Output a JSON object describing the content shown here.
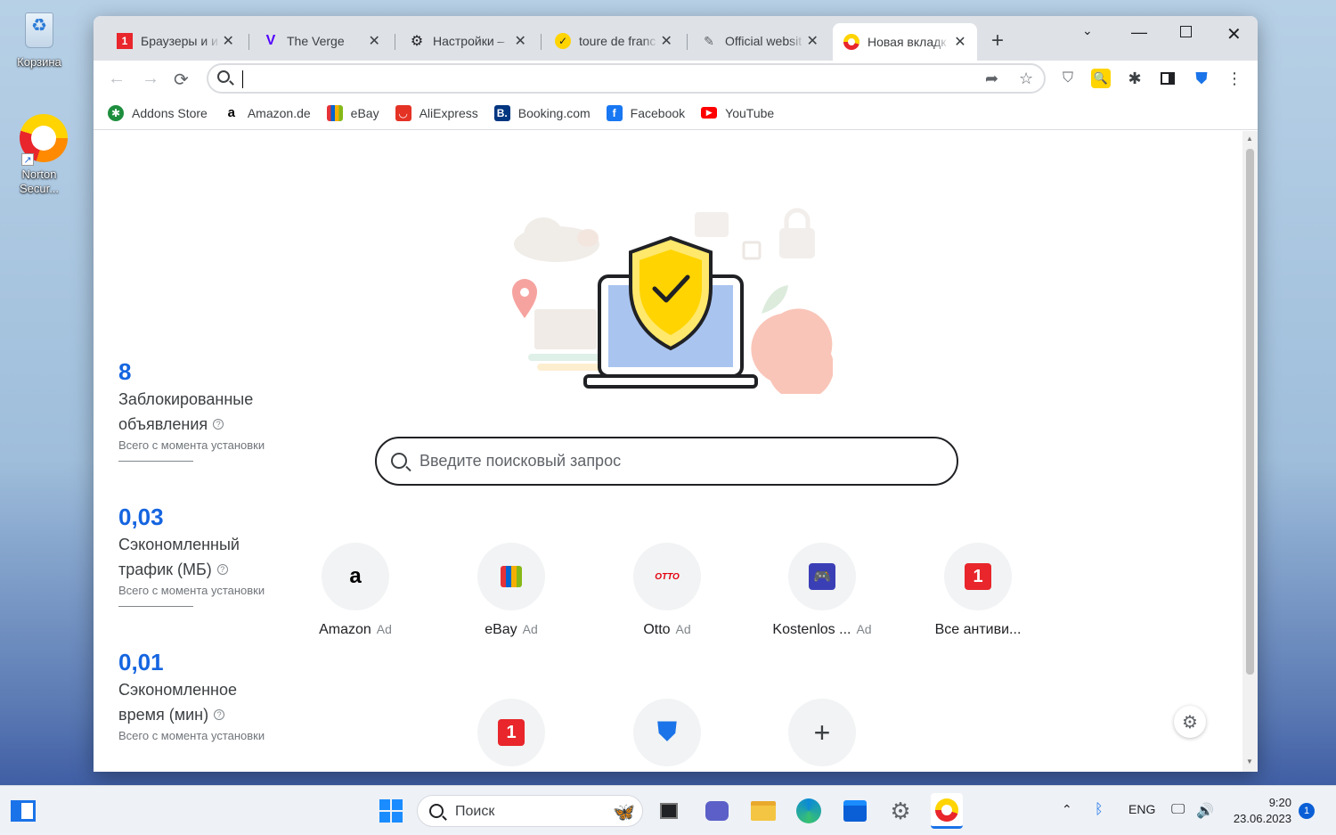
{
  "desktop": {
    "icons": [
      {
        "label": "Корзина"
      },
      {
        "label": "Norton Secur..."
      }
    ]
  },
  "browser": {
    "tabs": [
      {
        "title": "Браузеры и и",
        "icon": "brand-1-icon",
        "active": false
      },
      {
        "title": "The Verge",
        "icon": "verge-icon",
        "active": false
      },
      {
        "title": "Настройки – ",
        "icon": "gear-icon",
        "active": false
      },
      {
        "title": "toure de franc",
        "icon": "check-icon",
        "active": false
      },
      {
        "title": "Official websit",
        "icon": "official-site-icon",
        "active": false
      },
      {
        "title": "Новая вкладк",
        "icon": "norton-icon",
        "active": true
      }
    ],
    "omnibox_value": "",
    "bookmarks": [
      {
        "label": "Addons Store",
        "icon": "addons-icon",
        "color": "#1e8e3e"
      },
      {
        "label": "Amazon.de",
        "icon": "amazon-icon",
        "color": "#000000"
      },
      {
        "label": "eBay",
        "icon": "ebay-icon",
        "color": "#e53238"
      },
      {
        "label": "AliExpress",
        "icon": "aliexpress-icon",
        "color": "#e43225"
      },
      {
        "label": "Booking.com",
        "icon": "booking-icon",
        "color": "#003580"
      },
      {
        "label": "Facebook",
        "icon": "facebook-icon",
        "color": "#1877f2"
      },
      {
        "label": "YouTube",
        "icon": "youtube-icon",
        "color": "#ff0000"
      }
    ]
  },
  "newtab": {
    "stats": [
      {
        "value": "8",
        "label_line1": "Заблокированные",
        "label_line2": "объявления",
        "sub": "Всего с момента установки"
      },
      {
        "value": "0,03",
        "label_line1": "Сэкономленный",
        "label_line2": "трафик (МБ)",
        "sub": "Всего с момента установки"
      },
      {
        "value": "0,01",
        "label_line1": "Сэкономленное",
        "label_line2": "время (мин)",
        "sub": "Всего с момента установки"
      }
    ],
    "search_placeholder": "Введите поисковый запрос",
    "tiles_row1": [
      {
        "name": "Amazon",
        "ad": "Ad",
        "logo": "a"
      },
      {
        "name": "eBay",
        "ad": "Ad",
        "logo": ""
      },
      {
        "name": "Otto",
        "ad": "Ad",
        "logo": "OTTO"
      },
      {
        "name": "Kostenlos ...",
        "ad": "Ad",
        "logo": ""
      },
      {
        "name": "Все антиви...",
        "ad": "",
        "logo": "1"
      }
    ],
    "tiles_row2": [
      {
        "name": "",
        "logo": "1"
      },
      {
        "name": "",
        "logo": ""
      },
      {
        "name": "",
        "logo": "+"
      }
    ]
  },
  "taskbar": {
    "search_placeholder": "Поиск",
    "lang": "ENG",
    "time": "9:20",
    "date": "23.06.2023",
    "notifications": "1"
  },
  "colors": {
    "accent_blue": "#1565e0",
    "norton_yellow": "#ffd400",
    "tabstrip": "#dee1e6"
  }
}
